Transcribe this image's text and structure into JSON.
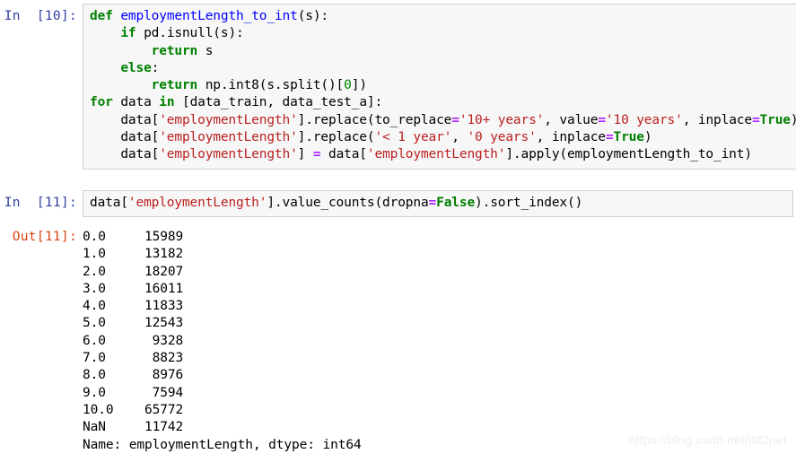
{
  "cells": [
    {
      "type": "code",
      "prompt": "In  [10]:",
      "source_lines": [
        "def employmentLength_to_int(s):",
        "    if pd.isnull(s):",
        "        return s",
        "    else:",
        "        return np.int8(s.split()[0])",
        "for data in [data_train, data_test_a]:",
        "    data['employmentLength'].replace(to_replace='10+ years', value='10 years', inplace=True)",
        "    data['employmentLength'].replace('< 1 year', '0 years', inplace=True)",
        "    data['employmentLength'] = data['employmentLength'].apply(employmentLength_to_int)"
      ]
    },
    {
      "type": "code",
      "prompt": "In  [11]:",
      "source_lines": [
        "data['employmentLength'].value_counts(dropna=False).sort_index()"
      ]
    }
  ],
  "output": {
    "prompt": "Out[11]:",
    "rows": [
      {
        "index": "0.0",
        "count": "15989"
      },
      {
        "index": "1.0",
        "count": "13182"
      },
      {
        "index": "2.0",
        "count": "18207"
      },
      {
        "index": "3.0",
        "count": "16011"
      },
      {
        "index": "4.0",
        "count": "11833"
      },
      {
        "index": "5.0",
        "count": "12543"
      },
      {
        "index": "6.0",
        "count": "9328"
      },
      {
        "index": "7.0",
        "count": "8823"
      },
      {
        "index": "8.0",
        "count": "8976"
      },
      {
        "index": "9.0",
        "count": "7594"
      },
      {
        "index": "10.0",
        "count": "65772"
      },
      {
        "index": "NaN",
        "count": "11742"
      }
    ],
    "footer": "Name: employmentLength, dtype: int64"
  },
  "watermark": {
    "text": "https://blog.csdn.net/ltlf2net"
  },
  "colors": {
    "prompt_in": "#303f9f",
    "prompt_out": "#d84315",
    "cell_background": "#f7f7f7",
    "cell_border": "#cfcfcf",
    "keyword": "#008000",
    "function_name": "#0000ff",
    "string": "#ba2121",
    "operator": "#aa22ff",
    "watermark": "#eeeeee"
  }
}
